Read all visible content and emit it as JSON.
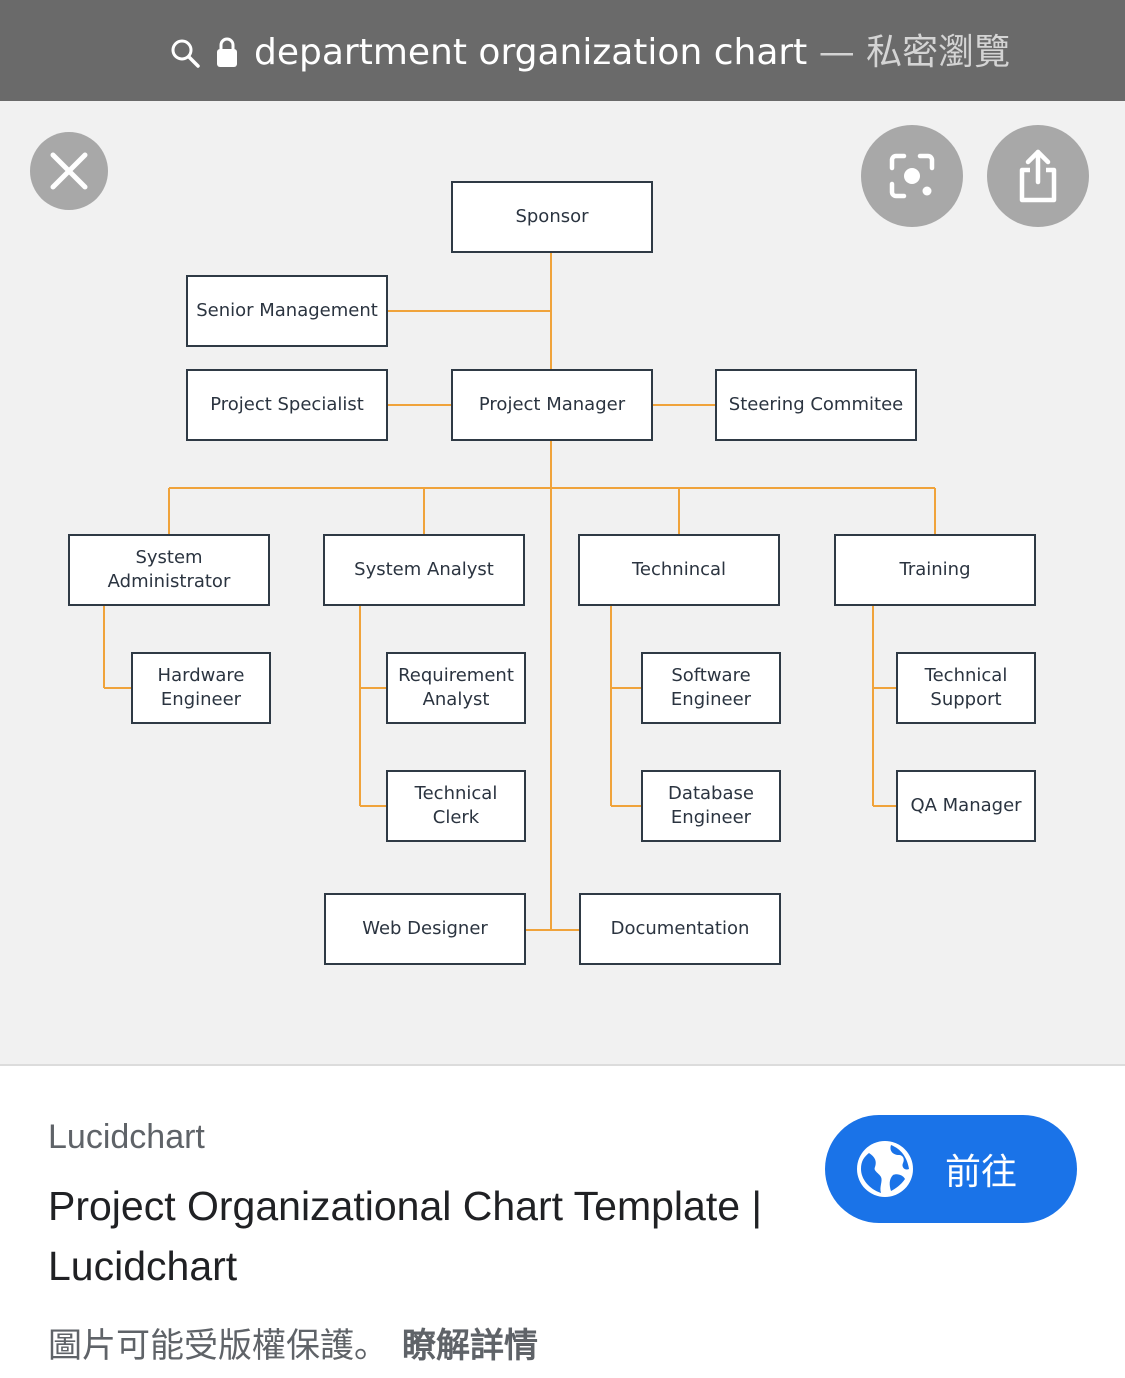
{
  "url_bar": {
    "title": "department organization chart",
    "suffix": " — 私密瀏覽",
    "icons": [
      "search-icon",
      "lock-icon"
    ]
  },
  "viewer": {
    "buttons": [
      "close-icon",
      "lens-icon",
      "share-icon"
    ]
  },
  "org_chart": {
    "line_color": "#f0a33b",
    "nodes": {
      "sponsor": [
        "Sponsor"
      ],
      "senior_management": [
        "Senior Management"
      ],
      "project_specialist": [
        "Project Specialist"
      ],
      "project_manager": [
        "Project Manager"
      ],
      "steering_committee": [
        "Steering Commitee"
      ],
      "system_administrator": [
        "System",
        "Administrator"
      ],
      "system_analyst": [
        "System Analyst"
      ],
      "technincal": [
        "Technincal"
      ],
      "training": [
        "Training"
      ],
      "hardware_engineer": [
        "Hardware",
        "Engineer"
      ],
      "requirement_analyst": [
        "Requirement",
        "Analyst"
      ],
      "software_engineer": [
        "Software",
        "Engineer"
      ],
      "technical_support": [
        "Technical",
        "Support"
      ],
      "technical_clerk": [
        "Technical",
        "Clerk"
      ],
      "database_engineer": [
        "Database",
        "Engineer"
      ],
      "qa_manager": [
        "QA Manager"
      ],
      "web_designer": [
        "Web Designer"
      ],
      "documentation": [
        "Documentation"
      ]
    }
  },
  "result": {
    "source": "Lucidchart",
    "title": "Project Organizational Chart Template | Lucidchart",
    "visit_label": "前往",
    "copyright_text": "圖片可能受版權保護。",
    "learn_more": "瞭解詳情",
    "accent_color": "#1a73e8"
  }
}
